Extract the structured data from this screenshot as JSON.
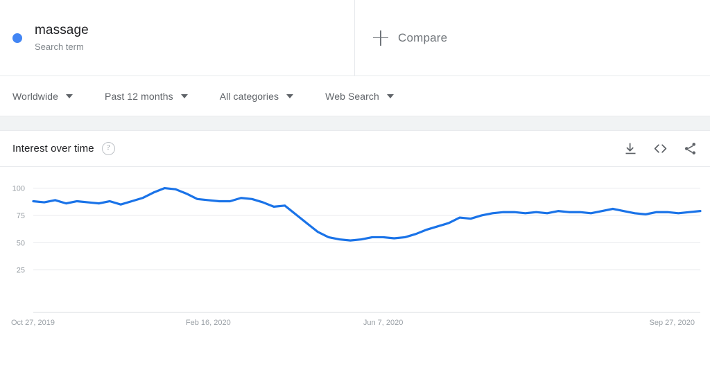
{
  "terms": [
    {
      "name": "massage",
      "type_label": "Search term",
      "dot_color": "#4285f4"
    }
  ],
  "compare": {
    "label": "Compare",
    "icon": "plus-icon"
  },
  "filters": [
    {
      "label": "Worldwide",
      "name": "region"
    },
    {
      "label": "Past 12 months",
      "name": "time-range"
    },
    {
      "label": "All categories",
      "name": "category"
    },
    {
      "label": "Web Search",
      "name": "search-type"
    }
  ],
  "card": {
    "title": "Interest over time",
    "help_glyph": "?",
    "actions": [
      {
        "name": "download-icon",
        "label": "Download"
      },
      {
        "name": "embed-code-icon",
        "label": "Embed"
      },
      {
        "name": "share-icon",
        "label": "Share"
      }
    ]
  },
  "chart_data": {
    "type": "line",
    "title": "Interest over time",
    "xlabel": "",
    "ylabel": "",
    "ylim": [
      0,
      108
    ],
    "yticks": [
      25,
      50,
      75,
      100
    ],
    "grid": true,
    "legend_position": "top-left",
    "accent_color": "#1a73e8",
    "x_tick_labels": [
      "Oct 27, 2019",
      "Feb 16, 2020",
      "Jun 7, 2020",
      "Sep 27, 2020"
    ],
    "x_tick_indices": [
      0,
      16,
      32,
      48
    ],
    "series": [
      {
        "name": "massage",
        "color": "#1a73e8",
        "values": [
          88,
          87,
          89,
          86,
          88,
          87,
          86,
          88,
          85,
          88,
          91,
          96,
          100,
          99,
          95,
          90,
          89,
          88,
          88,
          91,
          90,
          87,
          83,
          84,
          76,
          68,
          60,
          55,
          53,
          52,
          53,
          55,
          55,
          54,
          55,
          58,
          62,
          65,
          68,
          73,
          72,
          75,
          77,
          78,
          78,
          77,
          78,
          77,
          79,
          78,
          78,
          77,
          79,
          81,
          79,
          77,
          76,
          78,
          78,
          77,
          78,
          79
        ]
      }
    ]
  }
}
